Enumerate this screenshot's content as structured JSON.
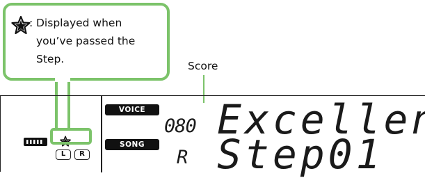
{
  "callout": {
    "colon": ":",
    "line1": "Displayed when",
    "line2": "you’ve passed the",
    "line3": "Step."
  },
  "score_label": "Score",
  "display": {
    "voice_tag": "VOICE",
    "song_tag": "SONG",
    "voice_number": "080",
    "voice_text": "Excellen",
    "song_number": "R",
    "song_text": "Step01",
    "left_button": "L",
    "right_button": "R"
  },
  "colors": {
    "accent_green": "#7cc36a",
    "lcd_black": "#111111"
  },
  "icons": [
    "star-icon",
    "keyboard-icon"
  ]
}
